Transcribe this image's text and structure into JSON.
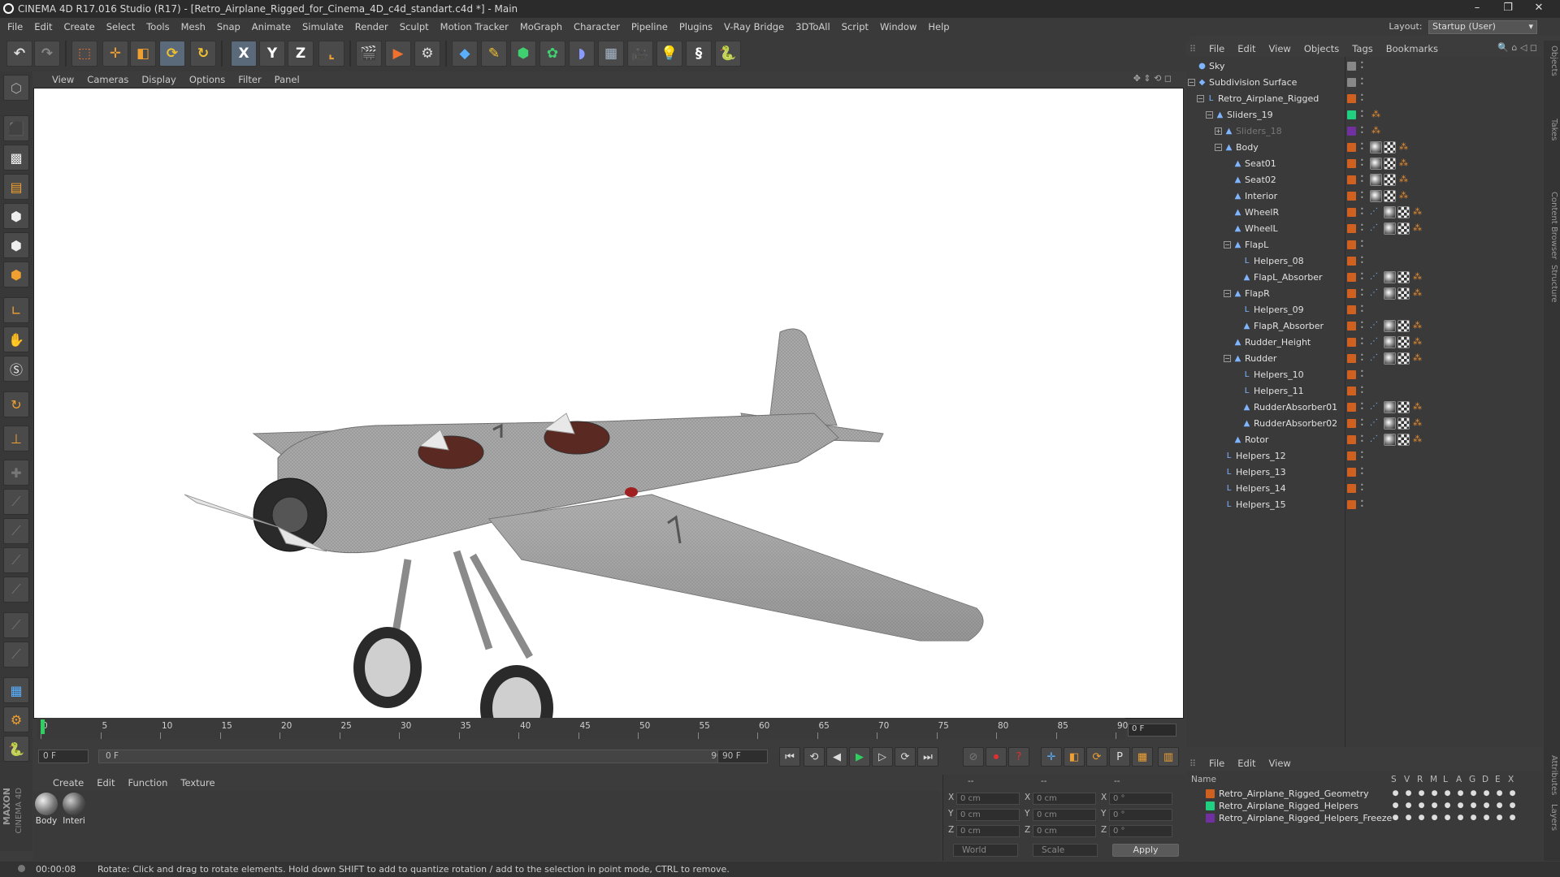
{
  "window": {
    "title": "CINEMA 4D R17.016 Studio (R17) - [Retro_Airplane_Rigged_for_Cinema_4D_c4d_standart.c4d *] - Main",
    "minimize": "–",
    "restore": "❐",
    "close": "✕"
  },
  "menu": [
    "File",
    "Edit",
    "Create",
    "Select",
    "Tools",
    "Mesh",
    "Snap",
    "Animate",
    "Simulate",
    "Render",
    "Sculpt",
    "Motion Tracker",
    "MoGraph",
    "Character",
    "Pipeline",
    "Plugins",
    "V-Ray Bridge",
    "3DToAll",
    "Script",
    "Window",
    "Help"
  ],
  "layout": {
    "label": "Layout:",
    "value": "Startup (User)"
  },
  "toolbar": {
    "x_label": "X",
    "y_label": "Y",
    "z_label": "Z"
  },
  "viewport_menu": [
    "View",
    "Cameras",
    "Display",
    "Options",
    "Filter",
    "Panel"
  ],
  "timeline": {
    "ticks": [
      "0",
      "5",
      "10",
      "15",
      "20",
      "25",
      "30",
      "35",
      "40",
      "45",
      "50",
      "55",
      "60",
      "65",
      "70",
      "75",
      "80",
      "85",
      "90"
    ],
    "current_frame": "0 F",
    "start_field": "0 F",
    "slider_start": "0 F",
    "slider_end": "90 F",
    "end_field": "90 F"
  },
  "material_menu": [
    "Create",
    "Edit",
    "Function",
    "Texture"
  ],
  "materials": [
    {
      "label": "Body"
    },
    {
      "label": "Interi"
    }
  ],
  "coords": {
    "col_headers": [
      "--",
      "--",
      "--"
    ],
    "rows": [
      {
        "a": "X",
        "av": "0 cm",
        "b": "X",
        "bv": "0 cm",
        "c": "X",
        "cv": "0 °"
      },
      {
        "a": "Y",
        "av": "0 cm",
        "b": "Y",
        "bv": "0 cm",
        "c": "Y",
        "cv": "0 °"
      },
      {
        "a": "Z",
        "av": "0 cm",
        "b": "Z",
        "bv": "0 cm",
        "c": "Z",
        "cv": "0 °"
      }
    ],
    "world": "World",
    "scale": "Scale",
    "apply": "Apply"
  },
  "status": {
    "time": "00:00:08",
    "message": "Rotate: Click and drag to rotate elements. Hold down SHIFT to add to quantize rotation / add to the selection in point mode, CTRL to remove."
  },
  "maxon": {
    "brand": "MAXON",
    "product": "CINEMA 4D"
  },
  "object_manager": {
    "menu": [
      "File",
      "Edit",
      "View",
      "Objects",
      "Tags",
      "Bookmarks"
    ],
    "objects": [
      {
        "name": "Sky",
        "level": 0,
        "fold": "",
        "icon": "●",
        "color": "#888888",
        "tags": []
      },
      {
        "name": "Subdivision Surface",
        "level": 0,
        "fold": "−",
        "icon": "◆",
        "color": "#888888",
        "tags": []
      },
      {
        "name": "Retro_Airplane_Rigged",
        "level": 1,
        "fold": "−",
        "icon": "L",
        "color": "#d06020",
        "tags": []
      },
      {
        "name": "Sliders_19",
        "level": 2,
        "fold": "−",
        "icon": "▲",
        "color": "#20d080",
        "tags": [
          "orange"
        ]
      },
      {
        "name": "Sliders_18",
        "level": 3,
        "fold": "+",
        "icon": "▲",
        "color": "#7030a0",
        "tags": [
          "orange"
        ],
        "dim": true
      },
      {
        "name": "Body",
        "level": 3,
        "fold": "−",
        "icon": "▲",
        "color": "#d06020",
        "tags": [
          "mat",
          "tex",
          "orange"
        ]
      },
      {
        "name": "Seat01",
        "level": 4,
        "fold": "",
        "icon": "▲",
        "color": "#d06020",
        "tags": [
          "mat",
          "tex",
          "orange"
        ]
      },
      {
        "name": "Seat02",
        "level": 4,
        "fold": "",
        "icon": "▲",
        "color": "#d06020",
        "tags": [
          "mat",
          "tex",
          "orange"
        ]
      },
      {
        "name": "Interior",
        "level": 4,
        "fold": "",
        "icon": "▲",
        "color": "#d06020",
        "tags": [
          "mat",
          "tex",
          "orange"
        ]
      },
      {
        "name": "WheelR",
        "level": 4,
        "fold": "",
        "icon": "▲",
        "color": "#d06020",
        "tags": [
          "dot",
          "mat",
          "tex",
          "orange"
        ]
      },
      {
        "name": "WheelL",
        "level": 4,
        "fold": "",
        "icon": "▲",
        "color": "#d06020",
        "tags": [
          "dot",
          "mat",
          "tex",
          "orange"
        ]
      },
      {
        "name": "FlapL",
        "level": 4,
        "fold": "−",
        "icon": "▲",
        "color": "#d06020",
        "tags": []
      },
      {
        "name": "Helpers_08",
        "level": 5,
        "fold": "",
        "icon": "L",
        "color": "#d06020",
        "tags": []
      },
      {
        "name": "FlapL_Absorber",
        "level": 5,
        "fold": "",
        "icon": "▲",
        "color": "#d06020",
        "tags": [
          "dot",
          "mat",
          "tex",
          "orange"
        ]
      },
      {
        "name": "FlapR",
        "level": 4,
        "fold": "−",
        "icon": "▲",
        "color": "#d06020",
        "tags": [
          "dot",
          "mat",
          "tex",
          "orange"
        ]
      },
      {
        "name": "Helpers_09",
        "level": 5,
        "fold": "",
        "icon": "L",
        "color": "#d06020",
        "tags": []
      },
      {
        "name": "FlapR_Absorber",
        "level": 5,
        "fold": "",
        "icon": "▲",
        "color": "#d06020",
        "tags": [
          "dot",
          "mat",
          "tex",
          "orange"
        ]
      },
      {
        "name": "Rudder_Height",
        "level": 4,
        "fold": "",
        "icon": "▲",
        "color": "#d06020",
        "tags": [
          "dot",
          "mat",
          "tex",
          "orange"
        ]
      },
      {
        "name": "Rudder",
        "level": 4,
        "fold": "−",
        "icon": "▲",
        "color": "#d06020",
        "tags": [
          "dot",
          "mat",
          "tex",
          "orange"
        ]
      },
      {
        "name": "Helpers_10",
        "level": 5,
        "fold": "",
        "icon": "L",
        "color": "#d06020",
        "tags": []
      },
      {
        "name": "Helpers_11",
        "level": 5,
        "fold": "",
        "icon": "L",
        "color": "#d06020",
        "tags": []
      },
      {
        "name": "RudderAbsorber01",
        "level": 5,
        "fold": "",
        "icon": "▲",
        "color": "#d06020",
        "tags": [
          "dot",
          "mat",
          "tex",
          "orange"
        ]
      },
      {
        "name": "RudderAbsorber02",
        "level": 5,
        "fold": "",
        "icon": "▲",
        "color": "#d06020",
        "tags": [
          "dot",
          "mat",
          "tex",
          "orange"
        ]
      },
      {
        "name": "Rotor",
        "level": 4,
        "fold": "",
        "icon": "▲",
        "color": "#d06020",
        "tags": [
          "dot",
          "mat",
          "tex",
          "orange"
        ]
      },
      {
        "name": "Helpers_12",
        "level": 3,
        "fold": "",
        "icon": "L",
        "color": "#d06020",
        "tags": []
      },
      {
        "name": "Helpers_13",
        "level": 3,
        "fold": "",
        "icon": "L",
        "color": "#d06020",
        "tags": []
      },
      {
        "name": "Helpers_14",
        "level": 3,
        "fold": "",
        "icon": "L",
        "color": "#d06020",
        "tags": []
      },
      {
        "name": "Helpers_15",
        "level": 3,
        "fold": "",
        "icon": "L",
        "color": "#d06020",
        "tags": []
      }
    ]
  },
  "layer_manager": {
    "menu": [
      "File",
      "Edit",
      "View"
    ],
    "headers": [
      "Name",
      "S",
      "V",
      "R",
      "M",
      "L",
      "A",
      "G",
      "D",
      "E",
      "X"
    ],
    "layers": [
      {
        "name": "Retro_Airplane_Rigged_Geometry",
        "color": "#d06020"
      },
      {
        "name": "Retro_Airplane_Rigged_Helpers",
        "color": "#20d080"
      },
      {
        "name": "Retro_Airplane_Rigged_Helpers_Freeze",
        "color": "#7030a0"
      }
    ]
  },
  "side_tabs": [
    "Objects",
    "Takes",
    "Content Browser",
    "Structure"
  ],
  "side_tabs_bottom": [
    "Attributes",
    "Layers"
  ]
}
